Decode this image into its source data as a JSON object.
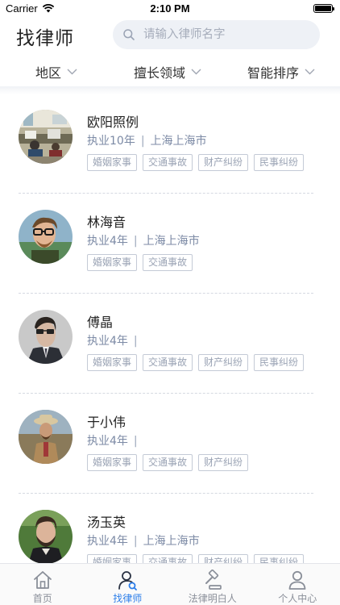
{
  "status_bar": {
    "carrier": "Carrier",
    "time": "2:10 PM"
  },
  "header": {
    "title": "找律师",
    "search_placeholder": "请输入律师名字"
  },
  "filters": [
    {
      "label": "地区"
    },
    {
      "label": "擅长领域"
    },
    {
      "label": "智能排序"
    }
  ],
  "lawyers": [
    {
      "name": "欧阳照例",
      "experience": "执业10年",
      "location": "上海上海市",
      "tags": [
        "婚姻家事",
        "交通事故",
        "财产纠纷",
        "民事纠纷"
      ],
      "avatar": "office-photo"
    },
    {
      "name": "林海音",
      "experience": "执业4年",
      "location": "上海上海市",
      "tags": [
        "婚姻家事",
        "交通事故"
      ],
      "avatar": "man-with-glasses"
    },
    {
      "name": "傅晶",
      "experience": "执业4年",
      "location": "",
      "tags": [
        "婚姻家事",
        "交通事故",
        "财产纠纷",
        "民事纠纷"
      ],
      "avatar": "man-in-suit"
    },
    {
      "name": "于小伟",
      "experience": "执业4年",
      "location": "",
      "tags": [
        "婚姻家事",
        "交通事故",
        "财产纠纷"
      ],
      "avatar": "man-with-hat"
    },
    {
      "name": "汤玉英",
      "experience": "执业4年",
      "location": "上海上海市",
      "tags": [
        "婚姻家事",
        "交通事故",
        "财产纠纷",
        "民事纠纷"
      ],
      "avatar": "man-with-beard"
    }
  ],
  "tab_bar": {
    "active_color": "#2b7de9",
    "items": [
      {
        "label": "首页",
        "icon": "home-icon",
        "active": false
      },
      {
        "label": "找律师",
        "icon": "find-lawyer-icon",
        "active": true
      },
      {
        "label": "法律明白人",
        "icon": "gavel-icon",
        "active": false
      },
      {
        "label": "个人中心",
        "icon": "person-icon",
        "active": false
      }
    ]
  }
}
